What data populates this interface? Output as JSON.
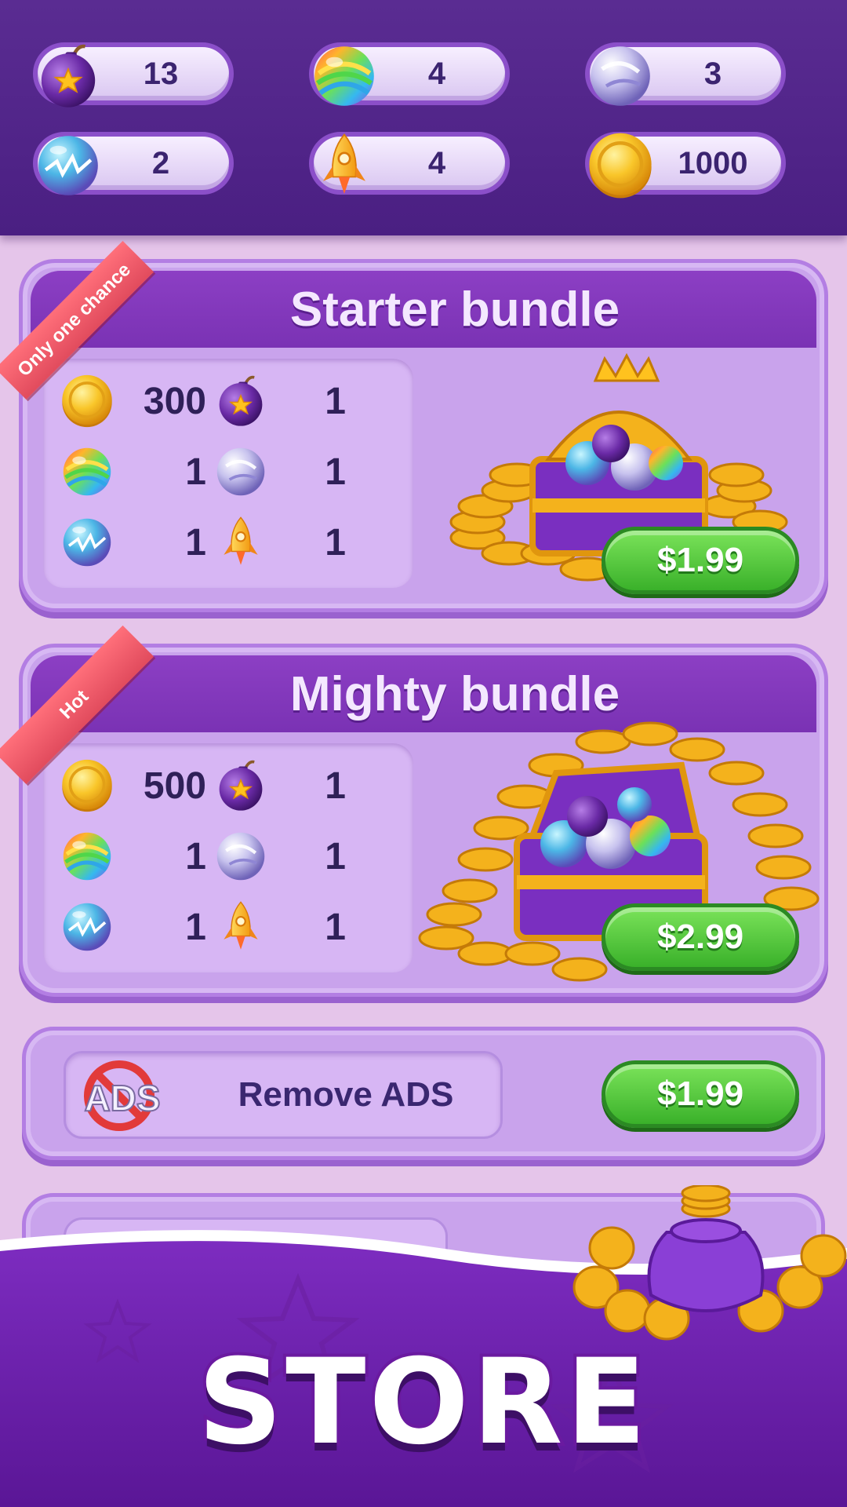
{
  "inventory": [
    {
      "icon": "bomb-icon",
      "count": "13"
    },
    {
      "icon": "rainbow-ball-icon",
      "count": "4"
    },
    {
      "icon": "silver-ball-icon",
      "count": "3"
    },
    {
      "icon": "lightning-ball-icon",
      "count": "2"
    },
    {
      "icon": "rocket-icon",
      "count": "4"
    },
    {
      "icon": "coin-icon",
      "count": "1000"
    }
  ],
  "starter": {
    "title": "Starter bundle",
    "ribbon": "Only one chance",
    "price": "$1.99",
    "items": [
      {
        "icon": "coin-icon",
        "qty": "300"
      },
      {
        "icon": "bomb-icon",
        "qty": "1"
      },
      {
        "icon": "rainbow-ball-icon",
        "qty": "1"
      },
      {
        "icon": "silver-ball-icon",
        "qty": "1"
      },
      {
        "icon": "lightning-ball-icon",
        "qty": "1"
      },
      {
        "icon": "rocket-icon",
        "qty": "1"
      }
    ]
  },
  "mighty": {
    "title": "Mighty bundle",
    "ribbon": "Hot",
    "price": "$2.99",
    "items": [
      {
        "icon": "coin-icon",
        "qty": "500"
      },
      {
        "icon": "bomb-icon",
        "qty": "1"
      },
      {
        "icon": "rainbow-ball-icon",
        "qty": "1"
      },
      {
        "icon": "silver-ball-icon",
        "qty": "1"
      },
      {
        "icon": "lightning-ball-icon",
        "qty": "1"
      },
      {
        "icon": "rocket-icon",
        "qty": "1"
      }
    ]
  },
  "remove_ads": {
    "icon_text": "ADS",
    "label": "Remove ADS",
    "price": "$1.99"
  },
  "store_title": "STORE",
  "colors": {
    "header_purple": "#4a1f82",
    "panel": "#c9a3ec",
    "button_green": "#3ab12a",
    "ribbon_red": "#e14b5d",
    "coin_gold": "#f6b81a"
  }
}
